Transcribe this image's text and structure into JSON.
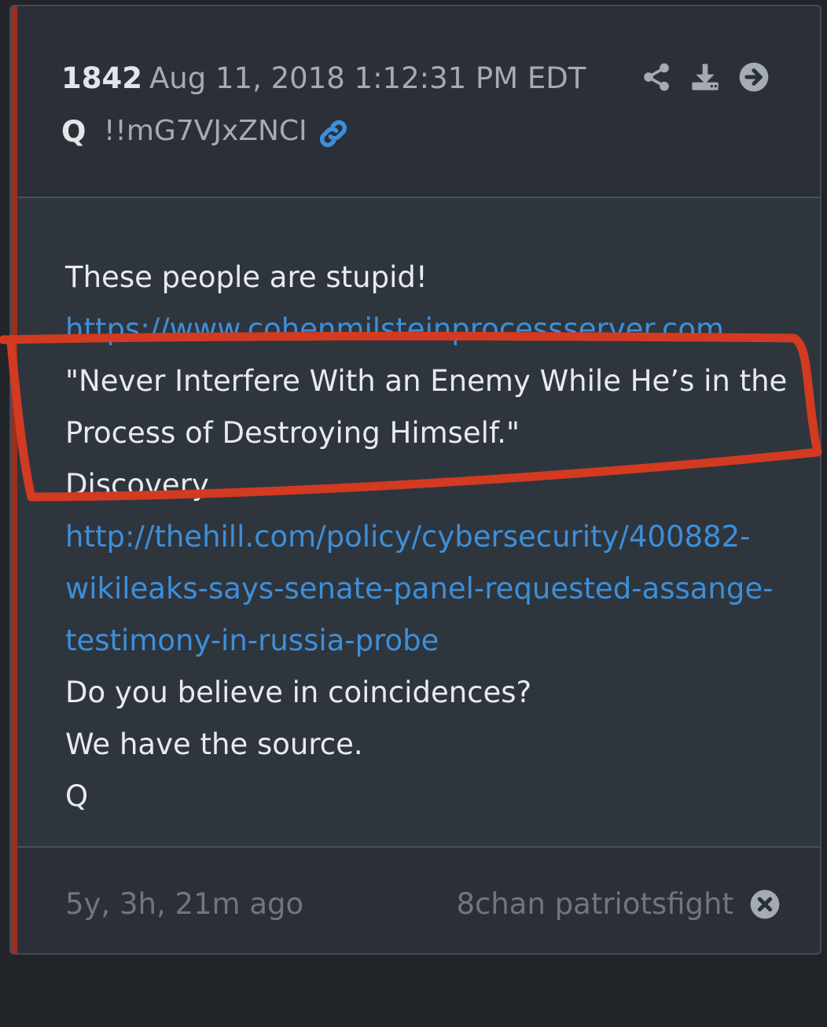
{
  "post": {
    "number": "1842",
    "date": "Aug 11, 2018 1:12:31 PM EDT",
    "author": "Q",
    "tripcode": "!!mG7VJxZNCI"
  },
  "header_icons": [
    "share-icon",
    "download-icon",
    "arrow-right-circle-icon"
  ],
  "body": {
    "line1": "These people are stupid!",
    "link1": "https://www.cohenmilsteinprocessserver.com",
    "quote_line1": "\"Never Interfere With an Enemy While He’s in the",
    "quote_line2": "Process of Destroying Himself.\"",
    "discovery": "Discovery.",
    "link2_part1": "http://thehill.com/policy/cybersecurity/400882-",
    "link2_part2": "wikileaks-says-senate-panel-requested-assange-",
    "link2_part3": "testimony-in-russia-probe",
    "line_coincidences": "Do you believe in coincidences?",
    "line_source": "We have the source.",
    "signature": "Q"
  },
  "footer": {
    "time_ago": "5y, 3h, 21m ago",
    "source": "8chan patriotsfight"
  },
  "colors": {
    "accent_bar": "#9a2f22",
    "link": "#3d8fd9",
    "annotation": "#d23a22"
  }
}
